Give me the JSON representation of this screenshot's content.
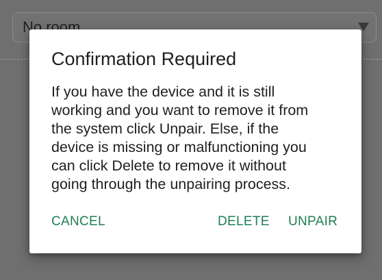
{
  "background": {
    "room_select": {
      "value": "No room"
    }
  },
  "dialog": {
    "title": "Confirmation Required",
    "message_lines": [
      "If you have the device and it is still",
      "working and you want to remove it from",
      "the system click Unpair. Else, if the",
      "device is missing or malfunctioning you",
      "can click Delete to remove it without",
      "going through the unpairing process."
    ],
    "buttons": {
      "cancel": "CANCEL",
      "delete": "DELETE",
      "unpair": "UNPAIR"
    }
  },
  "colors": {
    "accent": "#1e7d56",
    "scrim": "#6f6f6f",
    "dialog_bg": "#ffffff"
  },
  "icons": {
    "room_select_caret": "chevron-down-icon"
  }
}
